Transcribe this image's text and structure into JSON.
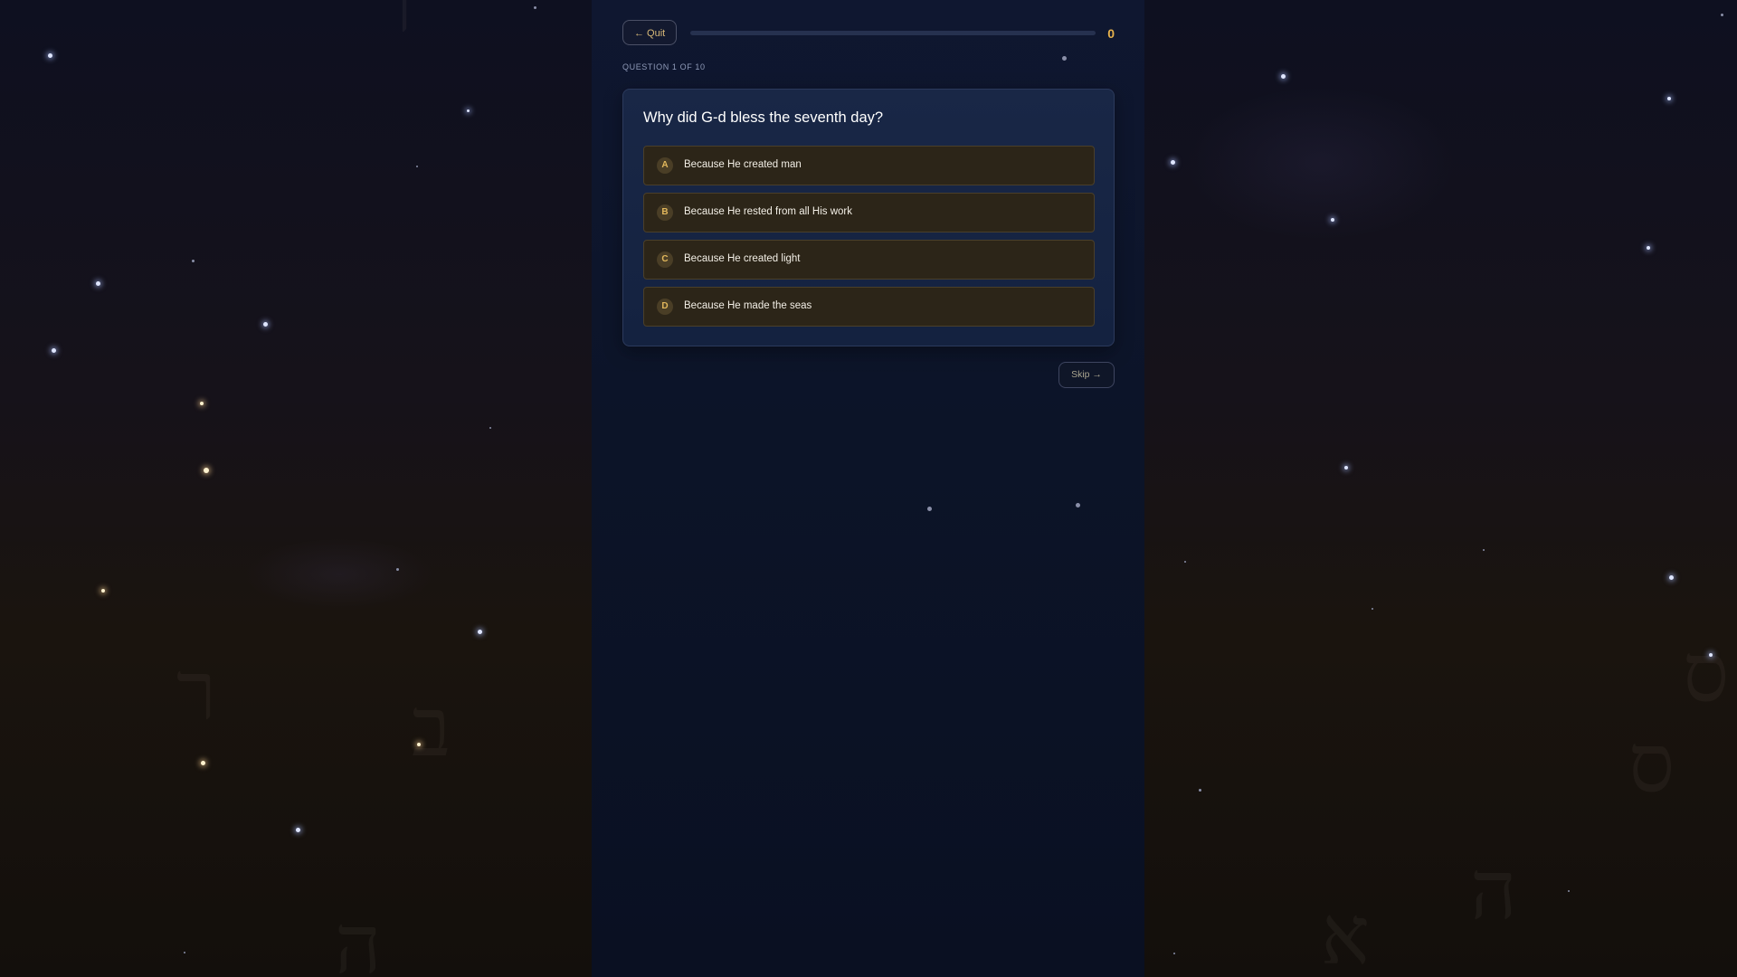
{
  "app": {
    "quit_label": "← Quit",
    "score": "0",
    "progress_fraction": 0
  },
  "quiz": {
    "counter": "QUESTION 1 OF 10",
    "question": "Why did G-d bless the seventh day?",
    "options": [
      {
        "letter": "A",
        "text": "Because He created man"
      },
      {
        "letter": "B",
        "text": "Because He rested from all His work"
      },
      {
        "letter": "C",
        "text": "Because He created light"
      },
      {
        "letter": "D",
        "text": "Because He made the seas"
      }
    ],
    "skip_label": "Skip →"
  },
  "colors": {
    "accent_gold": "#e7b24c",
    "option_bg": "#2c2518",
    "card_bg": "#192746",
    "column_bg": "#0f1730"
  },
  "icons": {
    "back": "left-arrow-icon",
    "skip": "right-arrow-icon"
  }
}
